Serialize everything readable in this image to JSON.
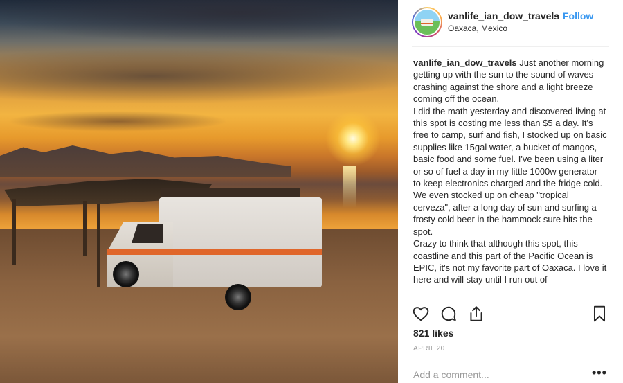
{
  "post": {
    "username": "vanlife_ian_dow_travels",
    "separator": "•",
    "follow_label": "Follow",
    "location": "Oaxaca, Mexico",
    "caption_user": "vanlife_ian_dow_travels",
    "caption_lines": [
      "Just another morning getting up with the sun to the sound of waves crashing against the shore and a light breeze coming off the ocean.",
      "I did the math yesterday and discovered living at this spot is costing me less than $5 a day. It's free to camp, surf and fish, I stocked up on basic supplies like 15gal water, a bucket of mangos, basic food and some fuel. I've been using a liter or so of fuel a day in my little 1000w generator to keep electronics charged and the fridge cold. We even stocked up on cheap \"tropical cerveza\", after a long day of sun and surfing a frosty cold beer in the hammock sure hits the spot.",
      "Crazy to think that although this spot, this coastline and this part of the Pacific Ocean is EPIC, it's not my favorite part of Oaxaca. I love it here and will stay until I run out of"
    ],
    "likes": "821 likes",
    "date": "APRIL 20",
    "comment_placeholder": "Add a comment...",
    "more_label": "•••"
  },
  "icons": {
    "like": "heart-icon",
    "comment": "comment-icon",
    "share": "share-icon",
    "save": "bookmark-icon"
  },
  "colors": {
    "accent": "#3897f0",
    "text": "#262626",
    "muted": "#999999",
    "divider": "#efefef"
  }
}
